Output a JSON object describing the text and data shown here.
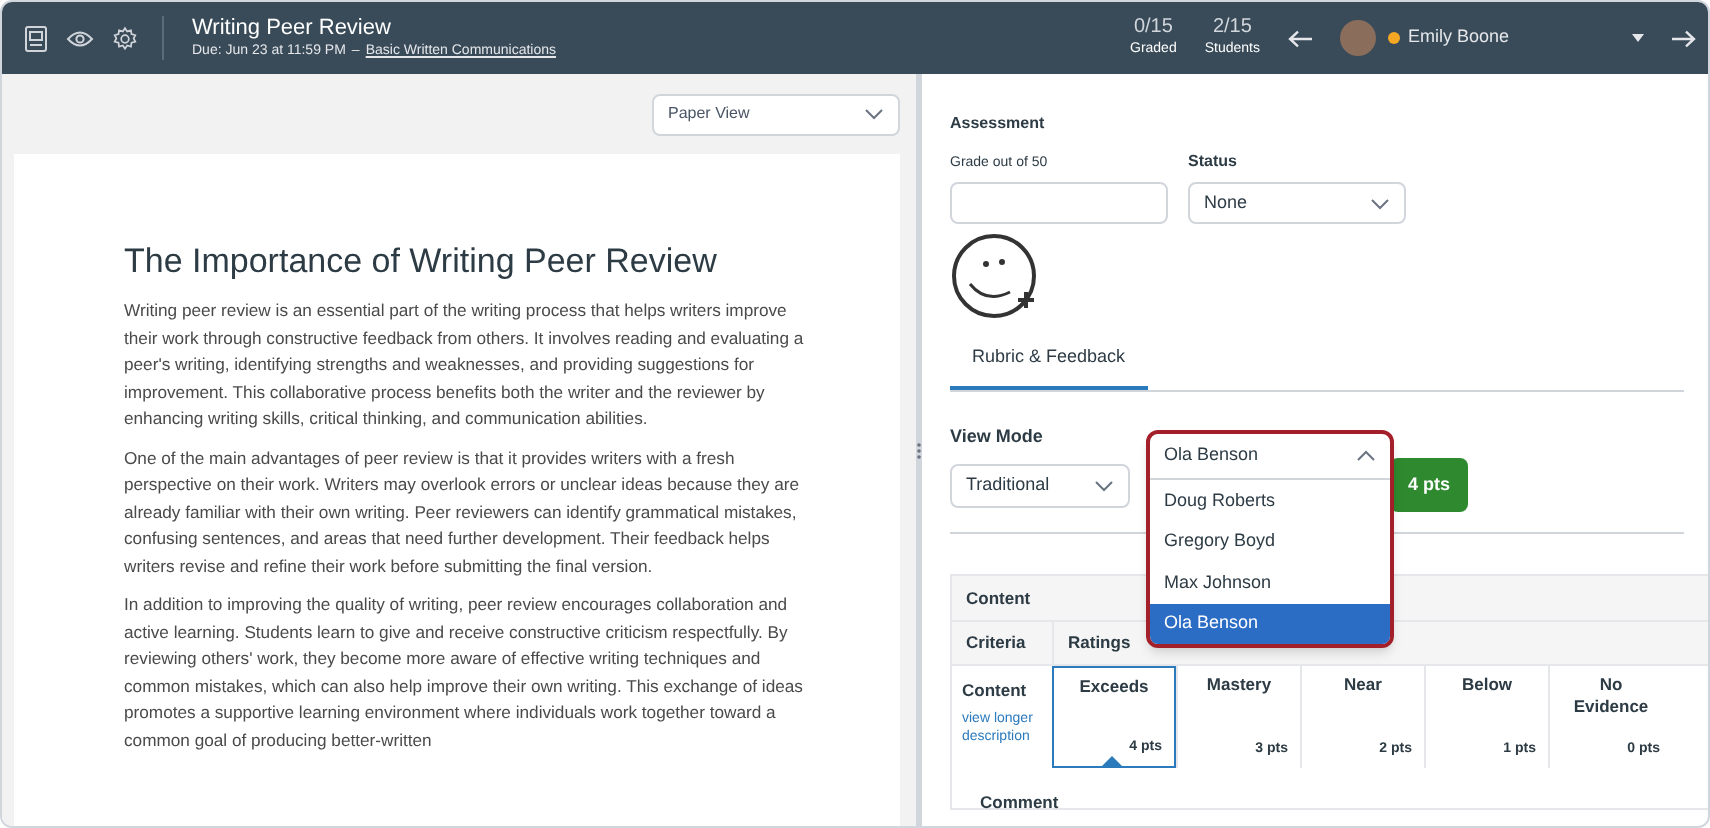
{
  "header": {
    "title": "Writing Peer Review",
    "due": "Due: Jun 23 at 11:59 PM",
    "separator": "–",
    "course_link": "Basic Written Communications",
    "stats": [
      {
        "value": "0/15",
        "label": "Graded"
      },
      {
        "value": "2/15",
        "label": "Students"
      }
    ],
    "student_name": "Emily Boone"
  },
  "document_view": {
    "view_select": "Paper View",
    "title": "The Importance of Writing Peer Review",
    "paragraphs": [
      "Writing peer review is an essential part of the writing process that helps writers improve their work through constructive feedback from others. It involves reading and evaluating a peer's writing, identifying strengths and weaknesses, and providing suggestions for improvement. This collaborative process benefits both the writer and the reviewer by enhancing writing skills, critical thinking, and communication abilities.",
      "One of the main advantages of peer review is that it provides writers with a fresh perspective on their work. Writers may overlook errors or unclear ideas because they are already familiar with their own writing. Peer reviewers can identify grammatical mistakes, confusing sentences, and areas that need further development. Their feedback helps writers revise and refine their work before submitting the final version.",
      "In addition to improving the quality of writing, peer review encourages collaboration and active learning. Students learn to give and receive constructive criticism respectfully. By reviewing others' work, they become more aware of effective writing techniques and common mistakes, which can also help improve their own writing. This exchange of ideas promotes a supportive learning environment where individuals work together toward a common goal of producing better-written"
    ]
  },
  "assessment": {
    "heading": "Assessment",
    "grade_label": "Grade out of 50",
    "status_label": "Status",
    "status_value": "None"
  },
  "tabs": [
    {
      "label": "Rubric & Feedback",
      "selected": true
    }
  ],
  "view_mode": {
    "label": "View Mode",
    "value": "Traditional"
  },
  "student_select": {
    "value": "Ola Benson",
    "expanded": true,
    "options": [
      {
        "label": "Doug Roberts",
        "selected": false
      },
      {
        "label": "Gregory Boyd",
        "selected": false
      },
      {
        "label": "Max Johnson",
        "selected": false
      },
      {
        "label": "Ola Benson",
        "selected": true
      }
    ]
  },
  "points_badge": "4 pts",
  "rubric": {
    "title": "Content",
    "criteria_header": "Criteria",
    "ratings_header": "Ratings",
    "criterion": {
      "name": "Content",
      "link": "view longer description"
    },
    "ratings": [
      {
        "label": "Exceeds",
        "points": "4 pts",
        "selected": true
      },
      {
        "label": "Mastery",
        "points": "3 pts",
        "selected": false
      },
      {
        "label": "Near",
        "points": "2 pts",
        "selected": false
      },
      {
        "label": "Below",
        "points": "1 pts",
        "selected": false
      },
      {
        "label": "No Evidence",
        "points": "0 pts",
        "selected": false
      }
    ],
    "comment_label": "Comment"
  }
}
